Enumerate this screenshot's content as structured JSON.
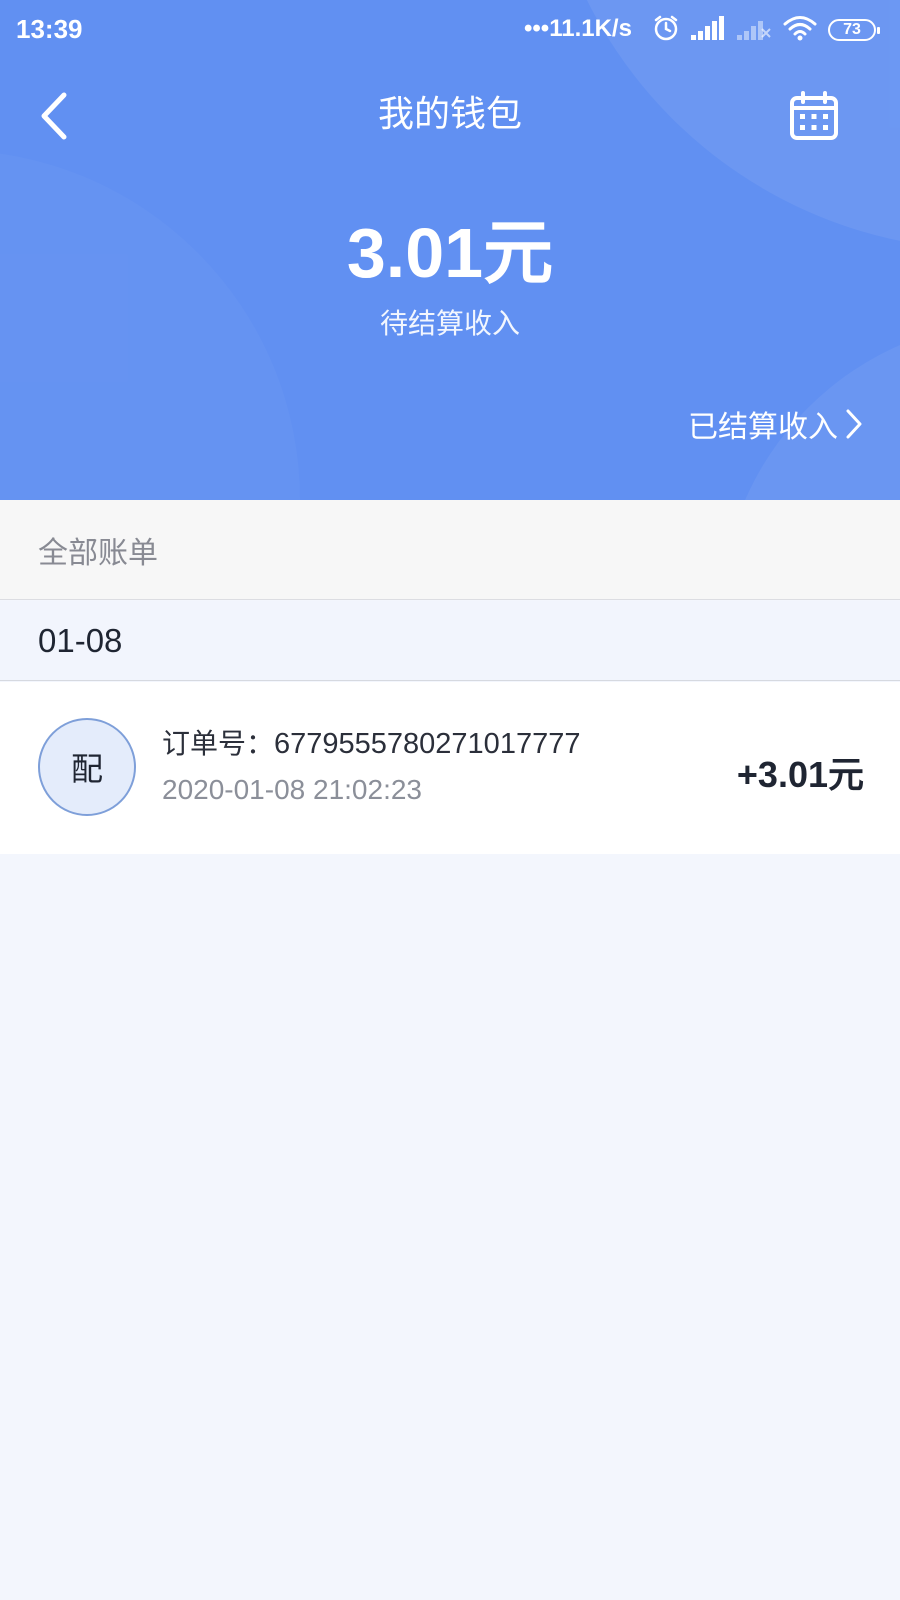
{
  "status_bar": {
    "time": "13:39",
    "network_speed": "•••11.1K/s",
    "battery": "73",
    "icons": [
      "alarm-icon",
      "signal-icon",
      "signal-off-icon",
      "wifi-icon",
      "battery-icon"
    ]
  },
  "header": {
    "title": "我的钱包",
    "back_icon": "chevron-left-icon",
    "calendar_icon": "calendar-icon",
    "amount": "3.01元",
    "amount_label": "待结算收入",
    "settled_link": "已结算收入",
    "settled_icon": "chevron-right-icon",
    "bg_color": "#6190f2"
  },
  "section": {
    "all_bills": "全部账单"
  },
  "bills": [
    {
      "date": "01-08",
      "avatar_char": "配",
      "order_label": "订单号：",
      "order_no": "6779555780271017777",
      "time": "2020-01-08 21:02:23",
      "amount": "+3.01元"
    }
  ]
}
